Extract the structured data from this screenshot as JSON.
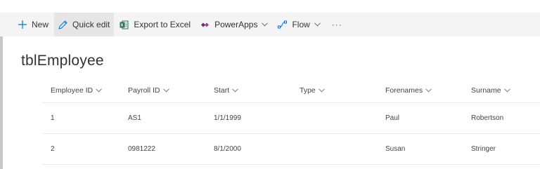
{
  "toolbar": {
    "new_label": "New",
    "quick_edit_label": "Quick edit",
    "export_label": "Export to Excel",
    "powerapps_label": "PowerApps",
    "flow_label": "Flow",
    "more_label": "···"
  },
  "list": {
    "title": "tblEmployee",
    "columns": [
      "Employee ID",
      "Payroll ID",
      "Start",
      "Type",
      "Forenames",
      "Surname"
    ],
    "rows": [
      [
        "1",
        "AS1",
        "1/1/1999",
        "",
        "Paul",
        "Robertson"
      ],
      [
        "2",
        "0981222",
        "8/1/2000",
        "",
        "Susan",
        "Stringer"
      ]
    ]
  },
  "colors": {
    "accent": "#0078d4",
    "excel_green": "#1e7145",
    "powerapps_purple": "#742774",
    "flow_blue": "#0066ff",
    "toolbar_bg": "#f4f4f4"
  }
}
